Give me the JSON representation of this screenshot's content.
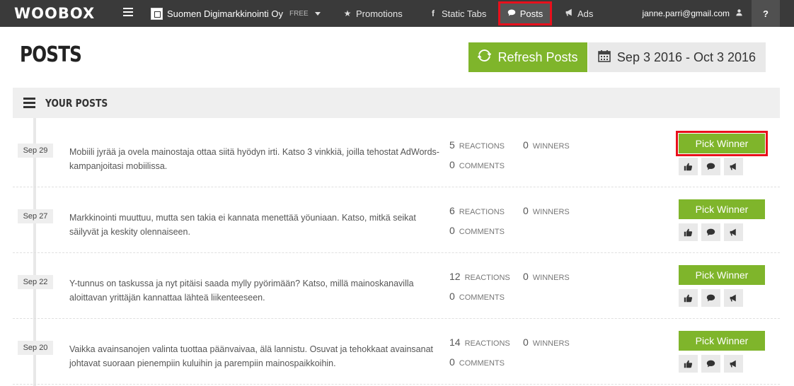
{
  "nav": {
    "logo": "WOOBOX",
    "page_name": "Suomen Digimarkkinointi Oy",
    "page_plan": "FREE",
    "items": [
      {
        "label": "Promotions",
        "icon": "star-icon"
      },
      {
        "label": "Static Tabs",
        "icon": "facebook-icon"
      },
      {
        "label": "Posts",
        "icon": "comment-icon"
      },
      {
        "label": "Ads",
        "icon": "megaphone-icon"
      }
    ],
    "user_email": "janne.parri@gmail.com",
    "help_label": "?"
  },
  "header": {
    "title": "POSTS",
    "refresh_label": "Refresh Posts",
    "date_range": "Sep 3 2016 - Oct 3 2016"
  },
  "section": {
    "title": "YOUR POSTS"
  },
  "posts": [
    {
      "date": "Sep 29",
      "text": "Mobiili jyrää ja ovela mainostaja ottaa siitä hyödyn irti. Katso 3 vinkkiä, joilla tehostat AdWords-kampanjoitasi mobiilissa.",
      "reactions": "5",
      "reactions_label": "REACTIONS",
      "comments": "0",
      "comments_label": "COMMENTS",
      "winners": "0",
      "winners_label": "WINNERS",
      "pick_label": "Pick Winner"
    },
    {
      "date": "Sep 27",
      "text": "Markkinointi muuttuu, mutta sen takia ei kannata menettää yöuniaan. Katso, mitkä seikat säilyvät ja keskity olennaiseen.",
      "reactions": "6",
      "reactions_label": "REACTIONS",
      "comments": "0",
      "comments_label": "COMMENTS",
      "winners": "0",
      "winners_label": "WINNERS",
      "pick_label": "Pick Winner"
    },
    {
      "date": "Sep 22",
      "text": "Y-tunnus on taskussa ja nyt pitäisi saada mylly pyörimään? Katso, millä mainoskanavilla aloittavan yrittäjän kannattaa lähteä liikenteeseen.",
      "reactions": "12",
      "reactions_label": "REACTIONS",
      "comments": "0",
      "comments_label": "COMMENTS",
      "winners": "0",
      "winners_label": "WINNERS",
      "pick_label": "Pick Winner"
    },
    {
      "date": "Sep 20",
      "text": "Vaikka avainsanojen valinta tuottaa päänvaivaa, älä lannistu. Osuvat ja tehokkaat avainsanat johtavat suoraan pienempiin kuluihin ja parempiin mainospaikkoihin.",
      "reactions": "14",
      "reactions_label": "REACTIONS",
      "comments": "0",
      "comments_label": "COMMENTS",
      "winners": "0",
      "winners_label": "WINNERS",
      "pick_label": "Pick Winner"
    }
  ],
  "colors": {
    "nav_bg": "#3a3a3a",
    "accent_green": "#7fb52b",
    "highlight_red": "#e8101c"
  }
}
